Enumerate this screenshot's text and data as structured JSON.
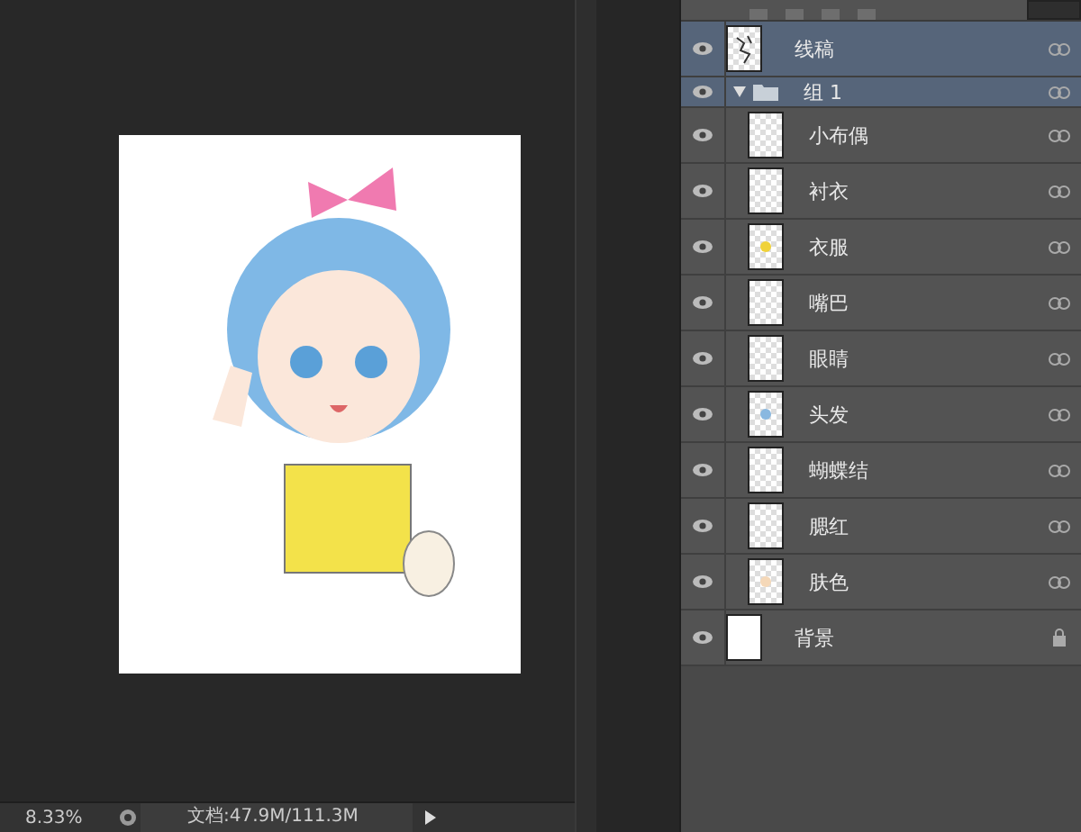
{
  "layers": [
    {
      "kind": "lineart",
      "name": "线稿",
      "visible": true,
      "selected": true,
      "locked": false
    },
    {
      "kind": "group",
      "name": "组 1",
      "visible": true,
      "selected": true,
      "expanded": true,
      "locked": false,
      "children": [
        {
          "kind": "layer",
          "name": "小布偶",
          "visible": true,
          "selected": false,
          "locked": false
        },
        {
          "kind": "layer",
          "name": "衬衣",
          "visible": true,
          "selected": false,
          "locked": false
        },
        {
          "kind": "layer",
          "name": "衣服",
          "visible": true,
          "selected": false,
          "color": "#f0d23a",
          "locked": false
        },
        {
          "kind": "layer",
          "name": "嘴巴",
          "visible": true,
          "selected": false,
          "locked": false
        },
        {
          "kind": "layer",
          "name": "眼睛",
          "visible": true,
          "selected": false,
          "locked": false
        },
        {
          "kind": "layer",
          "name": "头发",
          "visible": true,
          "selected": false,
          "color": "#8ab8e0",
          "locked": false
        },
        {
          "kind": "layer",
          "name": "蝴蝶结",
          "visible": true,
          "selected": false,
          "locked": false
        },
        {
          "kind": "layer",
          "name": "腮红",
          "visible": true,
          "selected": false,
          "locked": false
        },
        {
          "kind": "layer",
          "name": "肤色",
          "visible": true,
          "selected": false,
          "color": "#f5d8b8",
          "locked": false
        }
      ]
    },
    {
      "kind": "background",
      "name": "背景",
      "visible": true,
      "selected": false,
      "locked": true
    }
  ],
  "status_bar": {
    "zoom": "8.33%",
    "doc_info": "文档:47.9M/111.3M"
  }
}
